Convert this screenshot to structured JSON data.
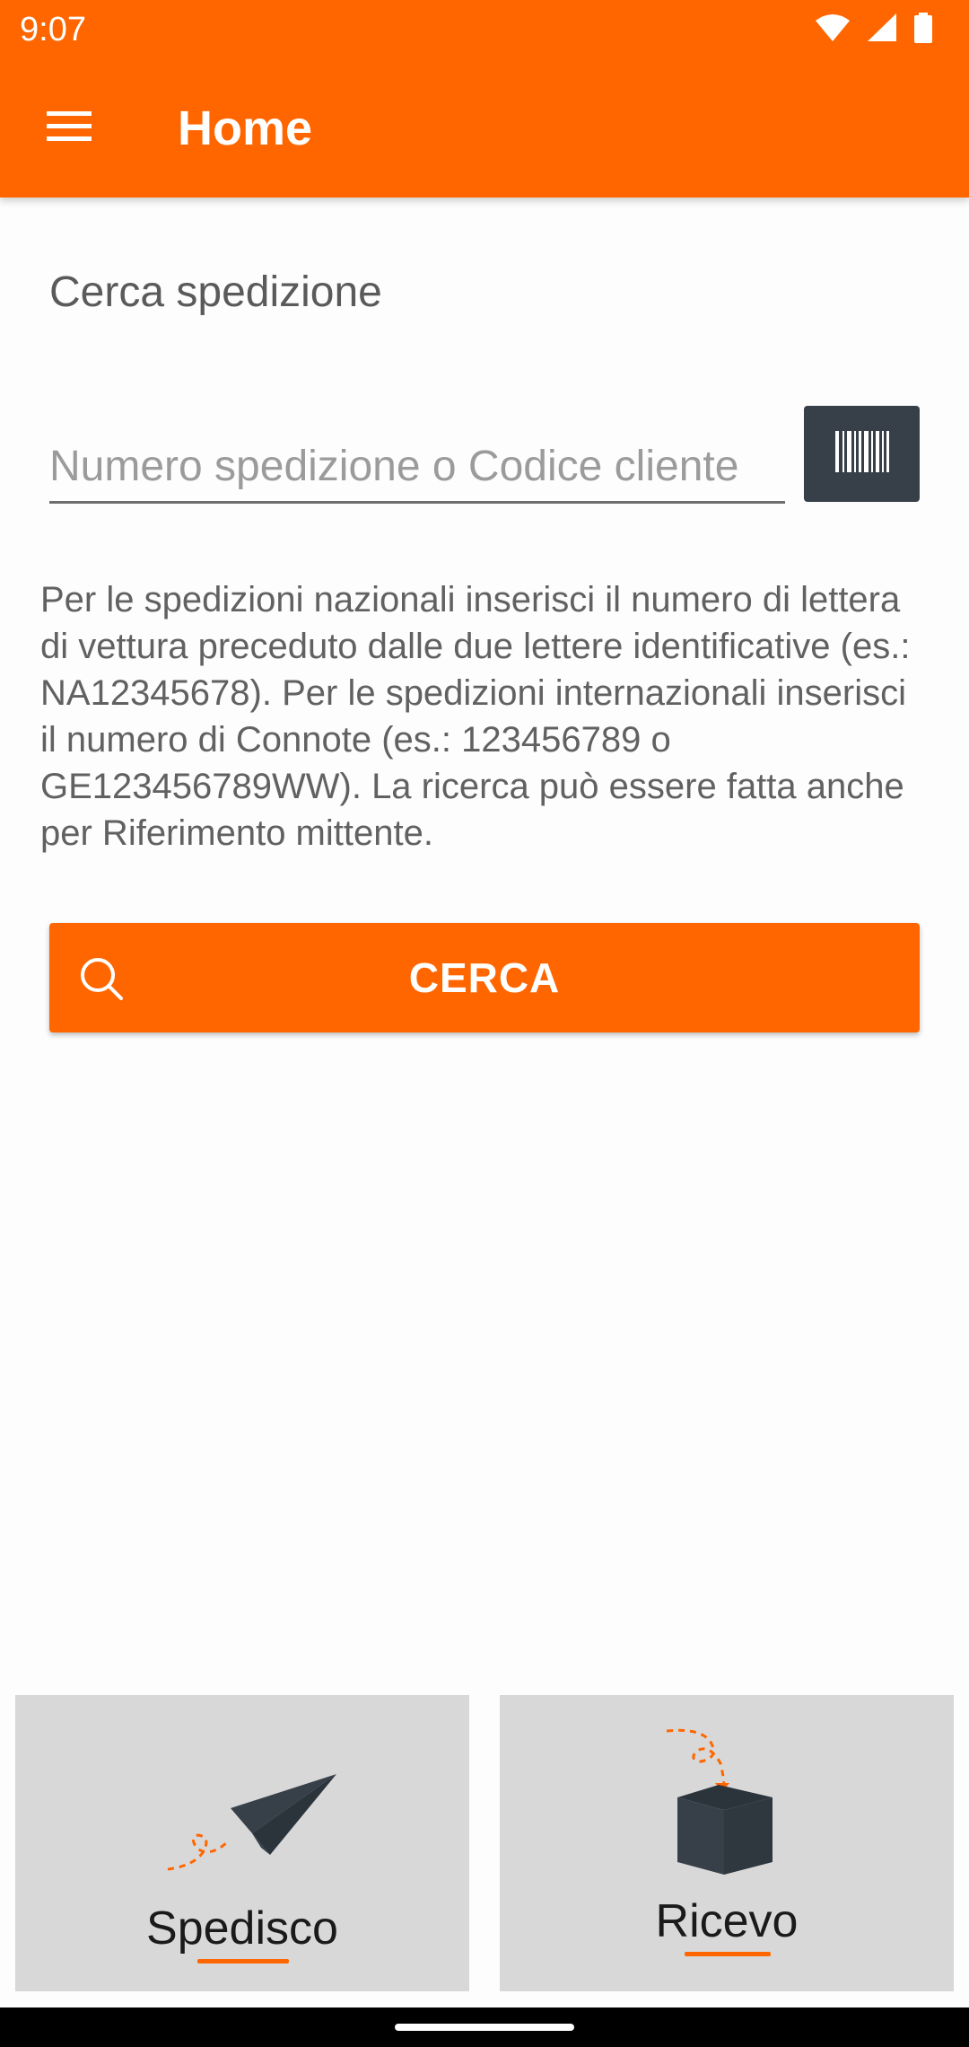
{
  "status_bar": {
    "time": "9:07",
    "icons": [
      "wifi-icon",
      "signal-icon",
      "battery-icon"
    ]
  },
  "app_bar": {
    "title": "Home",
    "menu_icon": "menu-icon"
  },
  "search": {
    "section_title": "Cerca spedizione",
    "placeholder": "Numero spedizione o Codice cliente",
    "value": "",
    "scan_icon": "barcode-icon",
    "help_text": "Per le spedizioni nazionali inserisci il numero di lettera di vettura preceduto dalle due lettere identificative (es.: NA12345678). Per le spedizioni internazionali inserisci il numero di Connote (es.: 123456789 o GE123456789WW). La ricerca può essere fatta anche per Riferimento mittente.",
    "button_label": "CERCA",
    "button_icon": "search-icon"
  },
  "tiles": [
    {
      "label": "Spedisco",
      "icon": "paper-plane-icon"
    },
    {
      "label": "Ricevo",
      "icon": "box-icon"
    }
  ],
  "colors": {
    "brand": "#ff6600",
    "dark": "#374049",
    "tile_bg": "#d8d8d8"
  }
}
